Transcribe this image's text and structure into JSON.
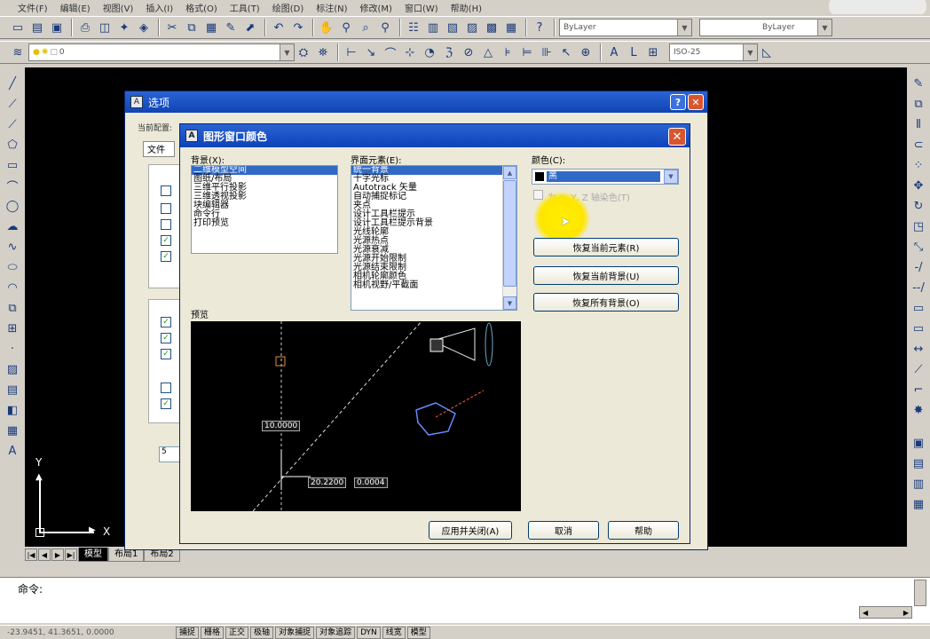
{
  "menubar": {
    "items": [
      "文件(F)",
      "编辑(E)",
      "视图(V)",
      "插入(I)",
      "格式(O)",
      "工具(T)",
      "绘图(D)",
      "标注(N)",
      "修改(M)",
      "窗口(W)",
      "帮助(H)"
    ]
  },
  "toolbar1": {
    "layer_combo": "ByLayer",
    "linetype_combo": "ByLayer"
  },
  "toolbar2": {
    "layer_state": "0",
    "dimstyle_combo": "ISO-25"
  },
  "canvas": {
    "ucs_x": "X",
    "ucs_y": "Y"
  },
  "layout_tabs": [
    "模型",
    "布局1",
    "布局2"
  ],
  "command": {
    "prompt": "命令:"
  },
  "status": {
    "coords": "-23.9451, 41.3651, 0.0000",
    "buttons": [
      "捕捉",
      "栅格",
      "正交",
      "极轴",
      "对象捕捉",
      "对象追踪",
      "DYN",
      "线宽",
      "模型"
    ]
  },
  "options_dialog": {
    "title": "选项",
    "current_config_label": "当前配置:",
    "tab_files": "文件",
    "field_value": "5"
  },
  "color_dialog": {
    "title": "图形窗口颜色",
    "context_label": "背景(X):",
    "context_items": [
      "二维模型空间",
      "图纸/布局",
      "三维平行投影",
      "三维透视投影",
      "块编辑器",
      "命令行",
      "打印预览"
    ],
    "element_label": "界面元素(E):",
    "element_items": [
      "统一背景",
      "十字光标",
      "Autotrack 矢量",
      "自动捕捉标记",
      "夹点",
      "设计工具栏提示",
      "设计工具栏提示背景",
      "光线轮廓",
      "光源热点",
      "光源衰减",
      "光源开始限制",
      "光源结束限制",
      "相机轮廓颜色",
      "相机视野/平截面"
    ],
    "color_label": "颜色(C):",
    "color_value": "黑",
    "tint_label": "为 X, Y, Z 轴染色(T)",
    "btn_restore_element": "恢复当前元素(R)",
    "btn_restore_context": "恢复当前背景(U)",
    "btn_restore_all": "恢复所有背景(O)",
    "preview_label": "预览",
    "preview_dim1": "10.0000",
    "preview_dim2": "20.2200",
    "preview_dim3": "0.0004",
    "btn_apply_close": "应用并关闭(A)",
    "btn_cancel": "取消",
    "btn_help": "帮助"
  },
  "colors": {
    "title_blue": "#1044b4",
    "selection": "#316ac5",
    "cursor_highlight": "#ffe600"
  }
}
